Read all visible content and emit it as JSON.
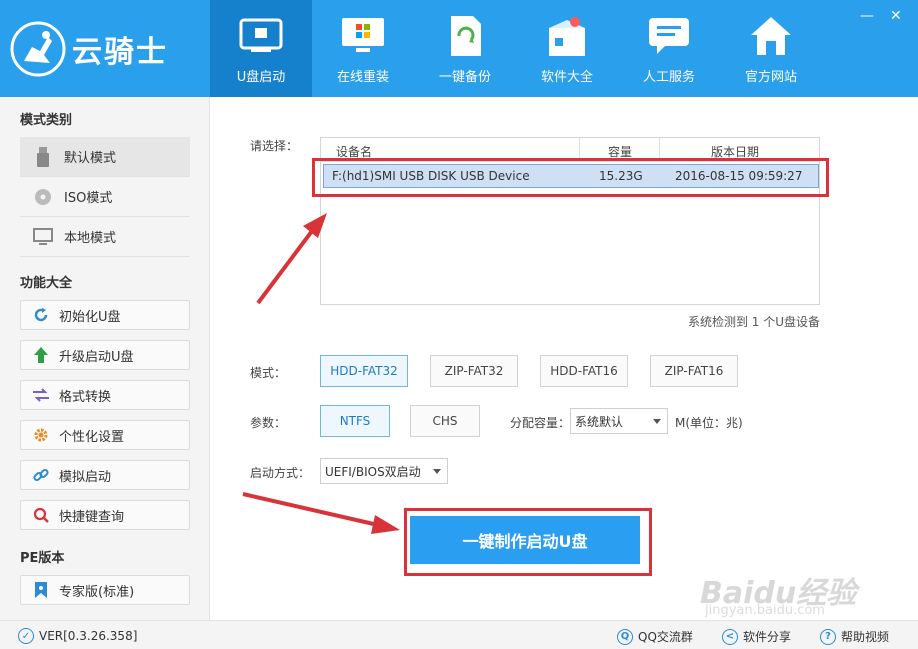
{
  "app": {
    "name": "云骑士",
    "window_controls": {
      "minimize": "—",
      "close": "✕"
    }
  },
  "nav": [
    {
      "label": "U盘启动",
      "icon": "usb-drive-icon",
      "active": true
    },
    {
      "label": "在线重装",
      "icon": "monitor-windows-icon",
      "active": false
    },
    {
      "label": "一键备份",
      "icon": "backup-file-icon",
      "active": false
    },
    {
      "label": "软件大全",
      "icon": "software-box-icon",
      "active": false
    },
    {
      "label": "人工服务",
      "icon": "chat-service-icon",
      "active": false
    },
    {
      "label": "官方网站",
      "icon": "home-icon",
      "active": false
    }
  ],
  "sidebar": {
    "mode_title": "模式类别",
    "modes": [
      {
        "label": "默认模式",
        "icon": "usb-stick-icon",
        "active": true
      },
      {
        "label": "ISO模式",
        "icon": "disc-icon",
        "active": false
      },
      {
        "label": "本地模式",
        "icon": "monitor-icon",
        "active": false
      }
    ],
    "func_title": "功能大全",
    "functions": [
      {
        "label": "初始化U盘",
        "icon": "refresh-icon",
        "color": "#2a8bd6"
      },
      {
        "label": "升级启动U盘",
        "icon": "arrow-up-icon",
        "color": "#2ea043"
      },
      {
        "label": "格式转换",
        "icon": "swap-icon",
        "color": "#7b5fc7"
      },
      {
        "label": "个性化设置",
        "icon": "gear-icon",
        "color": "#f08a24"
      },
      {
        "label": "模拟启动",
        "icon": "link-icon",
        "color": "#2a8bd6"
      },
      {
        "label": "快捷键查询",
        "icon": "search-icon",
        "color": "#d9333a"
      }
    ],
    "pe_title": "PE版本",
    "pe_items": [
      {
        "label": "专家版(标准)",
        "icon": "bookmark-icon",
        "color": "#2a8bd6"
      }
    ]
  },
  "main": {
    "select_label": "请选择：",
    "device_table": {
      "columns": [
        "设备名",
        "容量",
        "版本日期"
      ],
      "rows": [
        {
          "name": "F:(hd1)SMI USB DISK USB Device",
          "capacity": "15.23G",
          "date": "2016-08-15 09:59:27",
          "selected": true
        }
      ]
    },
    "detect_text": "系统检测到 1 个U盘设备",
    "mode_label": "模式：",
    "modes": [
      "HDD-FAT32",
      "ZIP-FAT32",
      "HDD-FAT16",
      "ZIP-FAT16"
    ],
    "mode_selected": "HDD-FAT32",
    "param_label": "参数：",
    "params": [
      "NTFS",
      "CHS"
    ],
    "param_selected": "NTFS",
    "alloc_label": "分配容量：",
    "alloc_value": "系统默认",
    "alloc_unit": "M(单位：兆)",
    "boot_label": "启动方式：",
    "boot_value": "UEFI/BIOS双启动",
    "make_button": "一键制作启动U盘"
  },
  "footer": {
    "version": "VER[0.3.26.358]",
    "links": [
      {
        "label": "QQ交流群",
        "icon": "qq-icon"
      },
      {
        "label": "软件分享",
        "icon": "share-icon"
      },
      {
        "label": "帮助视频",
        "icon": "help-icon"
      }
    ]
  },
  "watermark": {
    "brand": "Baidu经验",
    "url": "jingyan.baidu.com"
  },
  "colors": {
    "header": "#2aa0ec",
    "active_nav": "#1581cc",
    "accent": "#2a9ef0",
    "annotation_red": "#d9333a"
  }
}
